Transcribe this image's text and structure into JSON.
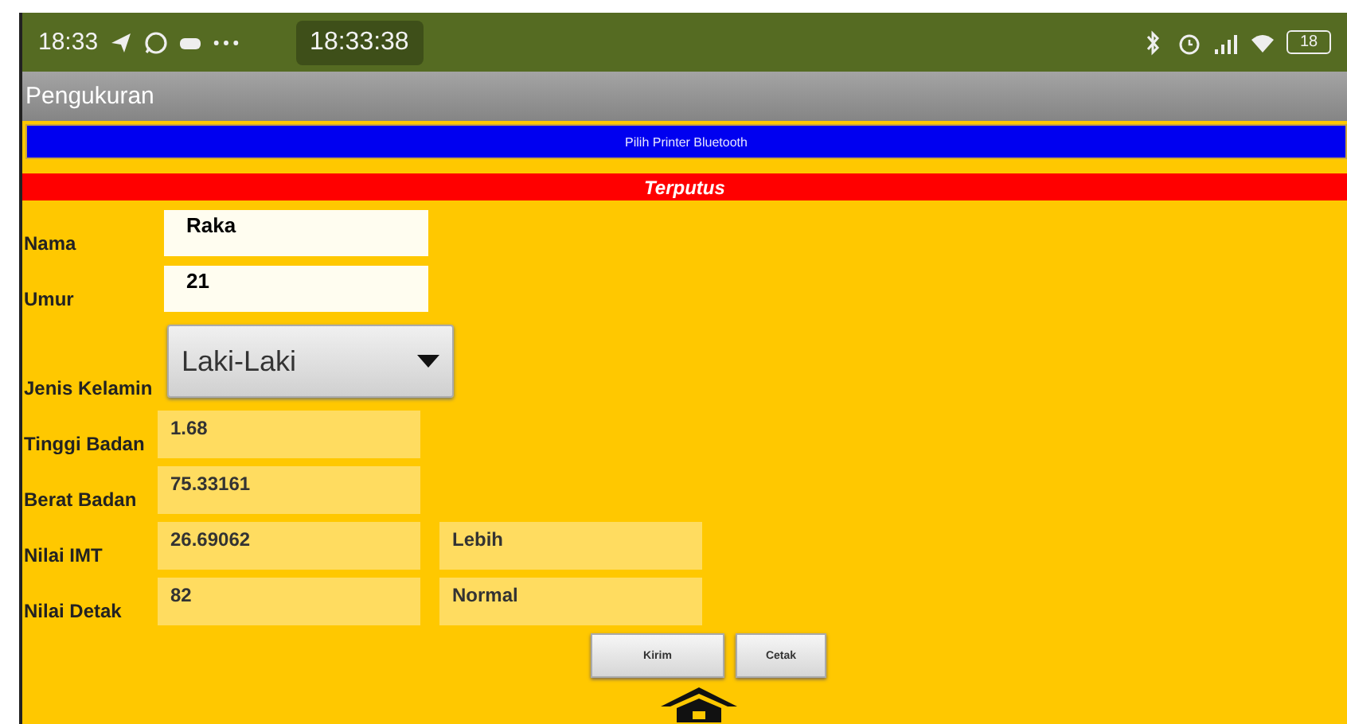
{
  "status_bar": {
    "time": "18:33",
    "clock": "18:33:38",
    "battery": "18"
  },
  "title": "Pengukuran",
  "printer_button": "Pilih Printer Bluetooth",
  "connection": "Terputus",
  "fields": [
    {
      "kind": "input",
      "label": "Nama",
      "value": "Raka"
    },
    {
      "kind": "input",
      "label": "Umur",
      "value": "21"
    },
    {
      "kind": "dropdown",
      "label": "Jenis Kelamin",
      "value": "Laki-Laki"
    },
    {
      "kind": "readout",
      "label": "Tinggi Badan",
      "value": "1.68"
    },
    {
      "kind": "readout",
      "label": "Berat Badan",
      "value": "75.33161"
    },
    {
      "kind": "readout",
      "label": "Nilai IMT",
      "value": "26.69062",
      "result": "Lebih"
    },
    {
      "kind": "readout",
      "label": "Nilai Detak",
      "value": "82",
      "result": "Normal"
    }
  ],
  "buttons": [
    "Kirim",
    "Cetak"
  ]
}
